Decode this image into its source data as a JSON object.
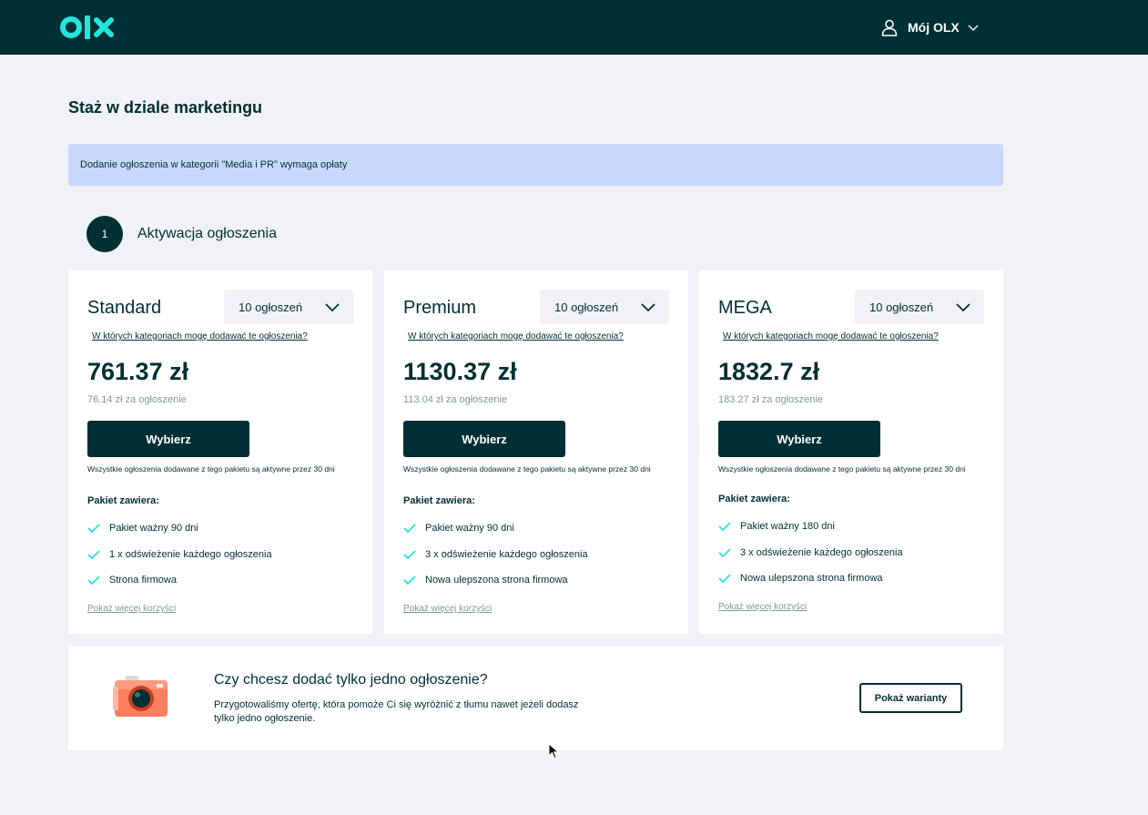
{
  "header": {
    "logo_text": "OLX",
    "account_label": "Mój OLX"
  },
  "page": {
    "title": "Staż w dziale marketingu",
    "notice": "Dodanie ogłoszenia w kategorii \"Media i PR\" wymaga opłaty",
    "step_number": "1",
    "step_label": "Aktywacja ogłoszenia"
  },
  "packages": [
    {
      "name": "Standard",
      "select_value": "10 ogłoszeń",
      "categories_link": "W których kategoriach mogę dodawać te ogłoszenia?",
      "price": "761.37 zł",
      "unit_price": "76.14 zł za ogłoszenie",
      "choose_label": "Wybierz",
      "active_note": "Wszystkie ogłoszenia dodawane z tego pakietu są aktywne przez 30 dni",
      "contains_label": "Pakiet zawiera:",
      "features": [
        "Pakiet ważny 90 dni",
        "1 x odświeżenie każdego ogłoszenia",
        "Strona firmowa"
      ],
      "more_link": "Pokaż więcej korzyści"
    },
    {
      "name": "Premium",
      "select_value": "10 ogłoszeń",
      "categories_link": "W których kategoriach mogę dodawać te ogłoszenia?",
      "price": "1130.37 zł",
      "unit_price": "113.04 zł za ogłoszenie",
      "choose_label": "Wybierz",
      "active_note": "Wszystkie ogłoszenia dodawane z tego pakietu są aktywne przez 30 dni",
      "contains_label": "Pakiet zawiera:",
      "features": [
        "Pakiet ważny 90 dni",
        "3 x odświeżenie każdego ogłoszenia",
        "Nowa ulepszona strona firmowa"
      ],
      "more_link": "Pokaż więcej korzyści"
    },
    {
      "name": "MEGA",
      "select_value": "10 ogłoszeń",
      "categories_link": "W których kategoriach mogę dodawać te ogłoszenia?",
      "price": "1832.7 zł",
      "unit_price": "183.27 zł za ogłoszenie",
      "choose_label": "Wybierz",
      "active_note": "Wszystkie ogłoszenia dodawane z tego pakietu są aktywne przez 30 dni",
      "contains_label": "Pakiet zawiera:",
      "features": [
        "Pakiet ważny 180 dni",
        "3 x odświeżenie każdego ogłoszenia",
        "Nowa ulepszona strona firmowa"
      ],
      "more_link": "Pokaż więcej korzyści"
    }
  ],
  "single_ad": {
    "title": "Czy chcesz dodać tylko jedno ogłoszenie?",
    "text": "Przygotowaliśmy ofertę, która pomoże Ci się wyróżnić z tłumu nawet jeżeli dodasz tylko jedno ogłoszenie.",
    "button_label": "Pokaż warianty"
  },
  "icons": {
    "logo": "olx-logo",
    "account": "user-icon",
    "account_chevron": "chevron-down-icon",
    "select_chevron": "chevron-down-icon",
    "feature": "check-icon",
    "single_ad": "camera-icon",
    "pointer": "mouse-cursor-icon"
  },
  "colors": {
    "brand_dark": "#002f34",
    "accent_teal": "#23e5db",
    "notice_bg": "#c8d8fb",
    "page_bg": "#f1f2f5",
    "muted_text": "#7f9799",
    "camera_orange": "#ff7e5f"
  }
}
